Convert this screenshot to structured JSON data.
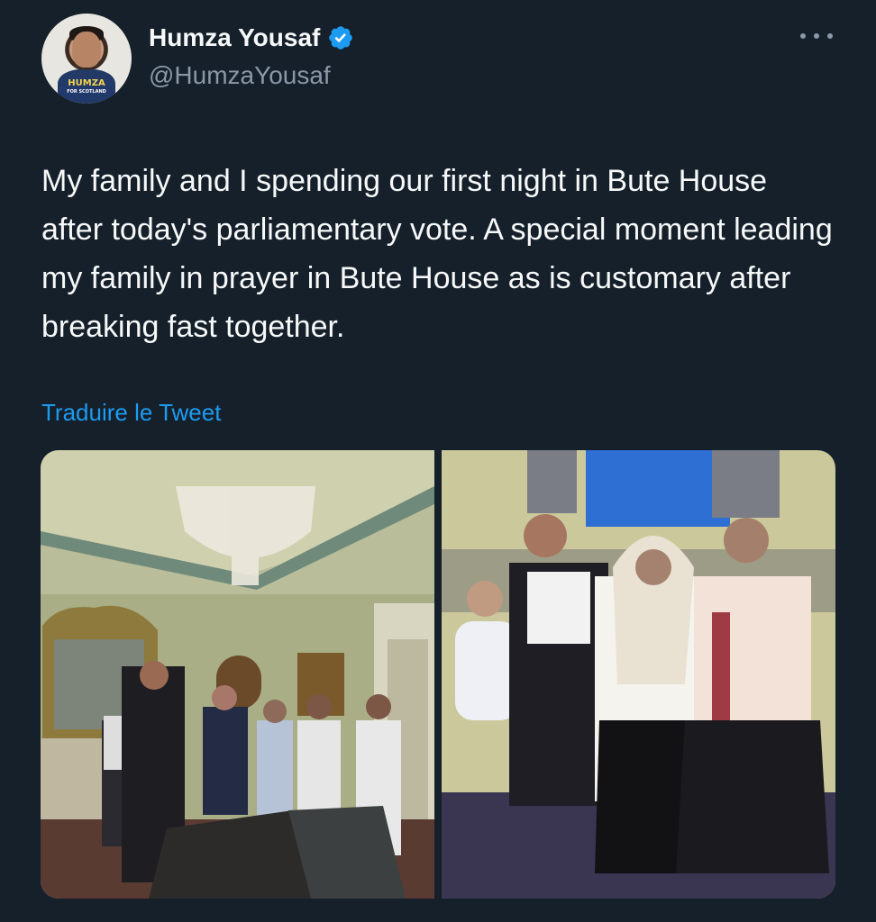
{
  "author": {
    "name": "Humza Yousaf",
    "handle": "@HumzaYousaf",
    "avatar_badge_line1": "HUMZA",
    "avatar_badge_line2": "FOR SCOTLAND",
    "verified_icon": "verified-badge-icon"
  },
  "tweet": {
    "text": "My family and I spending our first night in Bute House after today's parliamentary vote. A special moment leading my family in prayer in Bute House as is customary after breaking fast together.",
    "translate_label": "Traduire le Tweet"
  },
  "media": {
    "photos": [
      {
        "description_icon": "photo-drawing-room-prayer"
      },
      {
        "description_icon": "photo-family-on-sofa"
      }
    ]
  },
  "colors": {
    "background": "#15202b",
    "accent": "#1d9bf0",
    "secondary_text": "#8b98a5",
    "primary_text": "#f7f9f9"
  }
}
